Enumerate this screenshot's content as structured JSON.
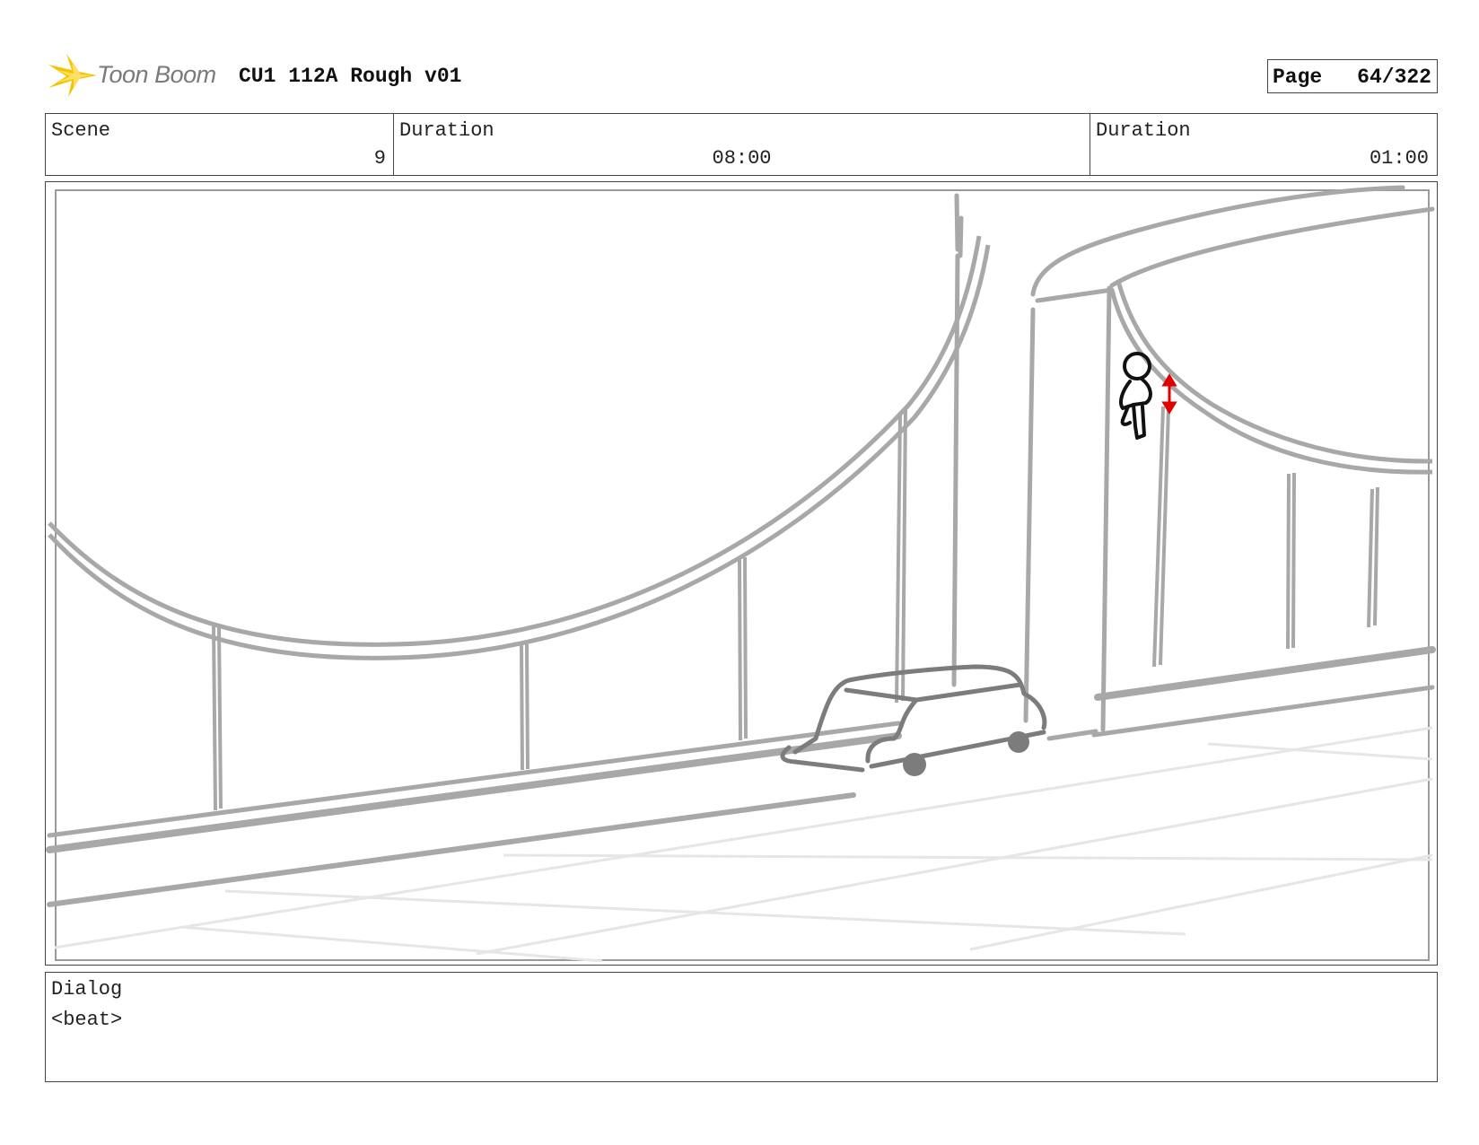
{
  "header": {
    "logo_text": "Toon Boom",
    "title": "CU1 112A Rough v01",
    "page_label": "Page",
    "page_value": "64/322"
  },
  "info": {
    "scene_label": "Scene",
    "scene_value": "9",
    "duration1_label": "Duration",
    "duration1_value": "08:00",
    "duration2_label": "Duration",
    "duration2_value": "01:00"
  },
  "panel": {
    "icon": "storyboard-sketch",
    "colors": {
      "sketch": "#a8a8a8",
      "ground": "#e6e6e6",
      "car": "#7c7c7c",
      "figure": "#111111",
      "motion_arrow": "#e00000"
    }
  },
  "dialog": {
    "label": "Dialog",
    "text": "<beat>"
  },
  "colors": {
    "logo_yellow": "#f5c400",
    "border": "#444444"
  }
}
